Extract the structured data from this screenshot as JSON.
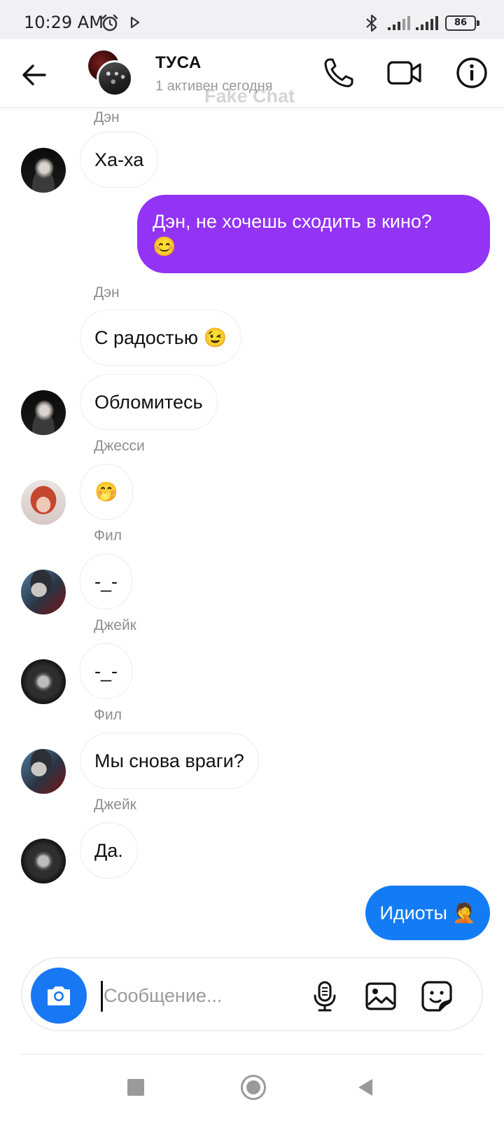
{
  "status_bar": {
    "time": "10:29 AM",
    "battery": "86"
  },
  "header": {
    "title": "ТУСА",
    "status": "1 активен сегодня",
    "watermark": "Fake Chat"
  },
  "messages": [
    {
      "sender": "Дэн",
      "text": "Ха-ха",
      "direction": "incoming",
      "avatar": "den"
    },
    {
      "text": "Дэн, не хочешь сходить в кино?",
      "emoji": "😊",
      "direction": "outgoing",
      "color": "#9333f5"
    },
    {
      "sender": "Дэн",
      "text": "С радостью 😉",
      "direction": "incoming"
    },
    {
      "text": "Обломитесь",
      "direction": "incoming",
      "avatar": "den"
    },
    {
      "sender": "Джесси",
      "text": "🤭",
      "direction": "incoming",
      "avatar": "jessi"
    },
    {
      "sender": "Фил",
      "text": "-_-",
      "direction": "incoming",
      "avatar": "fil"
    },
    {
      "sender": "Джейк",
      "text": "-_-",
      "direction": "incoming",
      "avatar": "jake"
    },
    {
      "sender": "Фил",
      "text": "Мы снова враги?",
      "direction": "incoming",
      "avatar": "fil"
    },
    {
      "sender": "Джейк",
      "text": "Да.",
      "direction": "incoming",
      "avatar": "jake"
    },
    {
      "text": "Идиоты 🤦",
      "direction": "outgoing",
      "color": "#137cf5"
    }
  ],
  "composer": {
    "placeholder": "Сообщение..."
  },
  "icons": {
    "back": "arrow-left-icon",
    "call": "phone-icon",
    "video": "video-camera-icon",
    "info": "info-icon",
    "camera": "camera-icon",
    "mic": "microphone-icon",
    "gallery": "image-icon",
    "sticker": "sticker-icon"
  },
  "colors": {
    "accent_purple": "#9333f5",
    "accent_blue": "#137cf5",
    "camera_button": "#1877f2"
  }
}
